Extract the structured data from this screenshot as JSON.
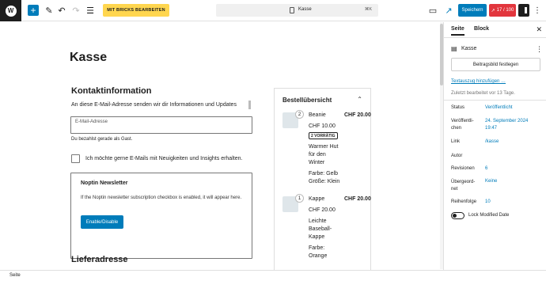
{
  "toolbar": {
    "bricks_label": "MIT BRICKS BEARBEITEN",
    "doc_title": "Kasse",
    "shortcut": "⌘K",
    "save_label": "Speichern",
    "seo_score": "17 / 100"
  },
  "canvas": {
    "page_title": "Kasse",
    "contact": {
      "heading": "Kontaktinformation",
      "intro": "An diese E-Mail-Adresse senden wir dir Informationen und Updates",
      "email_placeholder": "E-Mail-Adresse",
      "guest_note": "Du bezahlst gerade als Gast.",
      "newsletter_opt": "Ich möchte gerne E-Mails mit Neuigkeiten und Insights erhalten."
    },
    "noptin": {
      "title": "Noptin Newsletter",
      "description": "If the Noptin newsletter subscription checkbox is enabled, it will appear here.",
      "button": "Enable/Disable"
    },
    "shipping_heading": "Lieferadresse"
  },
  "summary": {
    "heading": "Bestellübersicht",
    "items": [
      {
        "qty": "2",
        "name": "Beanie",
        "total": "CHF 20.00",
        "unit_price": "CHF 10.00",
        "stock": "2 VORRÄTIG",
        "desc": [
          "Warmer Hut",
          "für den",
          "Winter"
        ],
        "attrs": [
          "Farbe: Gelb",
          "Größe: Klein"
        ]
      },
      {
        "qty": "1",
        "name": "Kappe",
        "total": "CHF 20.00",
        "unit_price": "CHF 20.00",
        "desc": [
          "Leichte",
          "Baseball-",
          "Kappe"
        ],
        "attrs": [
          "Farbe:",
          "Orange"
        ]
      }
    ]
  },
  "sidebar": {
    "tabs": [
      "Seite",
      "Block"
    ],
    "page_name": "Kasse",
    "featured_image": "Beitragsbild festlegen",
    "excerpt_link": "Textauszug hinzufügen …",
    "last_edited": "Zuletzt bearbeitet vor 13 Tage.",
    "rows": [
      {
        "label": "Status",
        "value": "Veröffentlicht"
      },
      {
        "label": "Veröffentli-chen",
        "value": "24. September 2024 19:47"
      },
      {
        "label": "Link",
        "value": "/kasse"
      },
      {
        "label": "Autor",
        "value": ""
      },
      {
        "label": "Revisionen",
        "value": "6"
      },
      {
        "label": "Übergeord-net",
        "value": "Keine"
      },
      {
        "label": "Reihenfolge",
        "value": "10"
      }
    ],
    "lock_label": "Lock Modified Date"
  },
  "footer": {
    "breadcrumb": "Seite"
  },
  "colors": {
    "accent": "#007cba",
    "bricks": "#ffd64f",
    "seo": "#e2363d"
  }
}
